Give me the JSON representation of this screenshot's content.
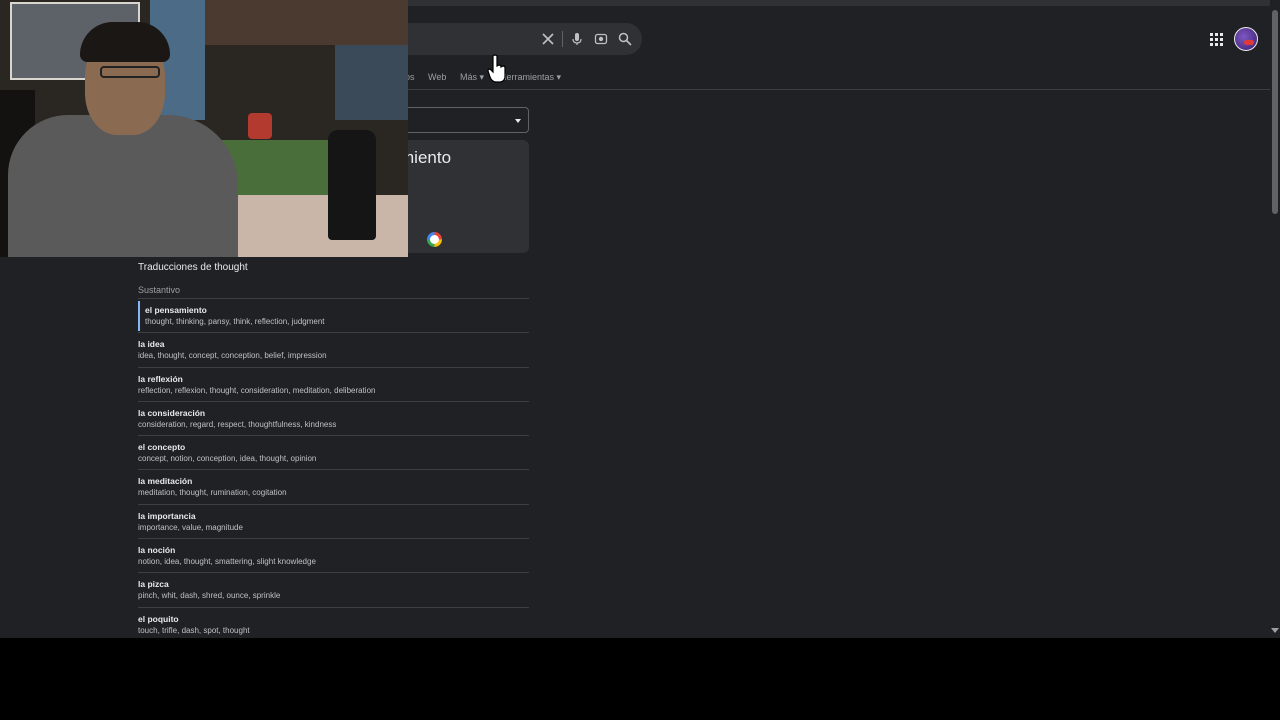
{
  "search": {
    "clear_icon": "close-icon",
    "mic_icon": "mic-icon",
    "lens_icon": "lens-icon",
    "search_icon": "search-icon"
  },
  "tabs": {
    "partial": "os",
    "web": "Web",
    "more": "Más",
    "tools": "Herramientas"
  },
  "translate_card": {
    "output_partial": "miento"
  },
  "translations": {
    "title": "Traducciones de thought",
    "part_of_speech": "Sustantivo",
    "rows": [
      {
        "word": "el pensamiento",
        "synonyms": "thought, thinking, pansy, think, reflection, judgment"
      },
      {
        "word": "la idea",
        "synonyms": "idea, thought, concept, conception, belief, impression"
      },
      {
        "word": "la reflexión",
        "synonyms": "reflection, reflexion, thought, consideration, meditation, deliberation"
      },
      {
        "word": "la consideración",
        "synonyms": "consideration, regard, respect, thoughtfulness, kindness"
      },
      {
        "word": "el concepto",
        "synonyms": "concept, notion, conception, idea, thought, opinion"
      },
      {
        "word": "la meditación",
        "synonyms": "meditation, thought, rumination, cogitation"
      },
      {
        "word": "la importancia",
        "synonyms": "importance, value, magnitude"
      },
      {
        "word": "la noción",
        "synonyms": "notion, idea, thought, smattering, slight knowledge"
      },
      {
        "word": "la pizca",
        "synonyms": "pinch, whit, dash, shred, ounce, sprinkle"
      },
      {
        "word": "el poquito",
        "synonyms": "touch, trifle, dash, spot, thought"
      }
    ]
  },
  "colors": {
    "background": "#202124",
    "surface": "#303134",
    "accent": "#8ab4f8",
    "text": "#e8eaed",
    "muted": "#9aa0a6"
  }
}
